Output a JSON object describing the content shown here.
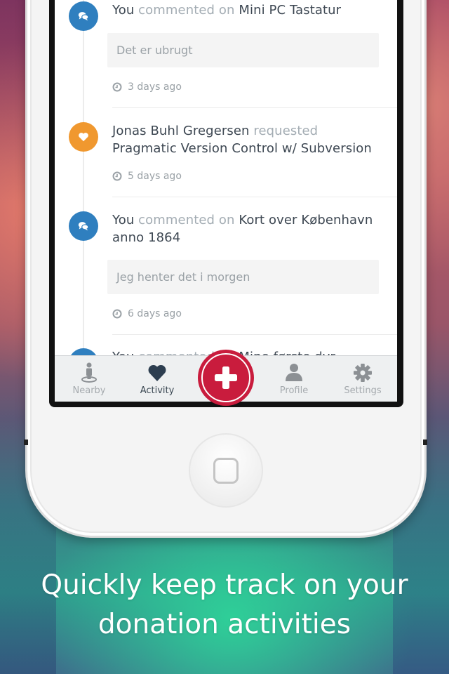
{
  "feed": [
    {
      "type": "comment",
      "actor": "You",
      "verb": "commented on",
      "object": "Mini PC Tastatur",
      "comment": "Det er ubrugt",
      "time": "3 days ago",
      "icon": "chat-bubbles-icon",
      "color": "#2f7fbf"
    },
    {
      "type": "request",
      "actor": "Jonas Buhl Gregersen",
      "verb": "requested",
      "object": "Pragmatic Version Control w/ Subversion",
      "time": "5 days ago",
      "icon": "heart-icon",
      "color": "#f0982f"
    },
    {
      "type": "comment",
      "actor": "You",
      "verb": "commented on",
      "object": "Kort over København anno 1864",
      "comment": "Jeg henter det i morgen",
      "time": "6 days ago",
      "icon": "chat-bubbles-icon",
      "color": "#2f7fbf"
    },
    {
      "type": "comment",
      "actor": "You",
      "verb": "commented on",
      "object": "Mine første dyr",
      "icon": "chat-bubbles-icon",
      "color": "#2f7fbf"
    }
  ],
  "tabbar": {
    "tabs": [
      {
        "label": "Nearby",
        "icon": "person-location-icon",
        "active": false
      },
      {
        "label": "Activity",
        "icon": "heart-icon",
        "active": true
      },
      {
        "label": "Profile",
        "icon": "user-icon",
        "active": false
      },
      {
        "label": "Settings",
        "icon": "gear-icon",
        "active": false
      }
    ],
    "add_button": {
      "icon": "plus-icon",
      "color": "#c91c3d"
    }
  },
  "tagline": {
    "line1": "Quickly keep track on your",
    "line2": "donation activities"
  }
}
